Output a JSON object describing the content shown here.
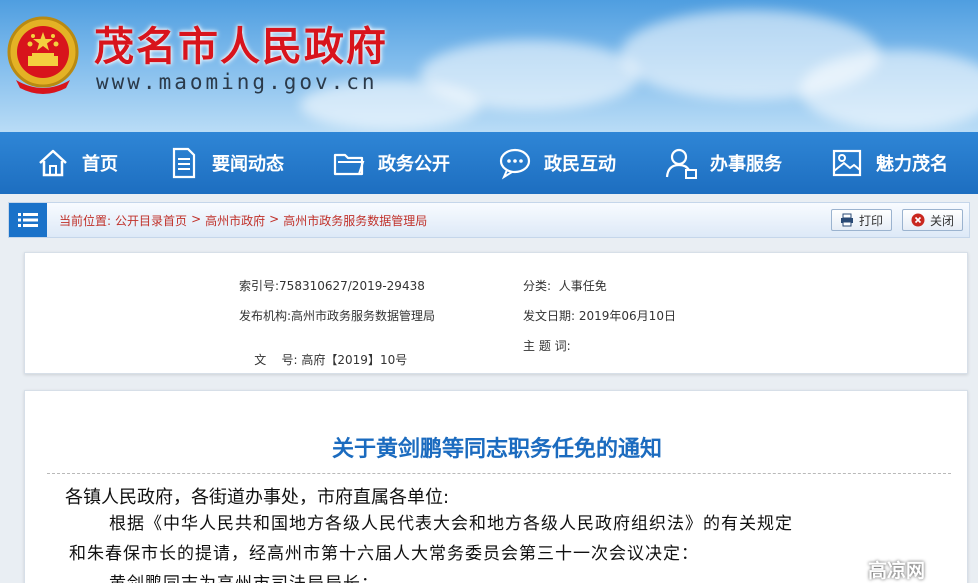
{
  "header": {
    "site_title": "茂名市人民政府",
    "site_url": "www.maoming.gov.cn"
  },
  "nav": {
    "items": [
      {
        "label": "首页",
        "icon": "home-icon"
      },
      {
        "label": "要闻动态",
        "icon": "document-icon"
      },
      {
        "label": "政务公开",
        "icon": "folder-icon"
      },
      {
        "label": "政民互动",
        "icon": "chat-icon"
      },
      {
        "label": "办事服务",
        "icon": "user-service-icon"
      },
      {
        "label": "魅力茂名",
        "icon": "image-icon"
      }
    ]
  },
  "breadcrumb": {
    "prefix": "当前位置:",
    "items": [
      "公开目录首页",
      "高州市政府",
      "高州市政务服务数据管理局"
    ],
    "separator": ">",
    "print_label": "打印",
    "close_label": "关闭"
  },
  "meta": {
    "index_label": "索引号:",
    "index_value": "758310627/2019-29438",
    "category_label": "分类:",
    "category_value": "人事任免",
    "issuer_label": "发布机构:",
    "issuer_value": "高州市政务服务数据管理局",
    "date_label": "发文日期:",
    "date_value": "2019年06月10日",
    "docno_label": "文    号:",
    "docno_value": "高府【2019】10号",
    "subject_label": "主 题 词:",
    "subject_value": ""
  },
  "article": {
    "title": "关于黄剑鹏等同志职务任免的通知",
    "salutation": "各镇人民政府，各街道办事处，市府直属各单位:",
    "line1": "根据《中华人民共和国地方各级人民代表大会和地方各级人民政府组织法》的有关规定",
    "line2": "和朱春保市长的提请，经高州市第十六届人大常务委员会第三十一次会议决定：",
    "line3": "黄剑鹏同志为高州市司法局局长；"
  },
  "watermark": {
    "text": "高凉网"
  },
  "colors": {
    "title_red": "#d8141c",
    "nav_blue": "#1d6ec0",
    "article_title_blue": "#1b6bbf",
    "crumb_red": "#c0312a"
  }
}
